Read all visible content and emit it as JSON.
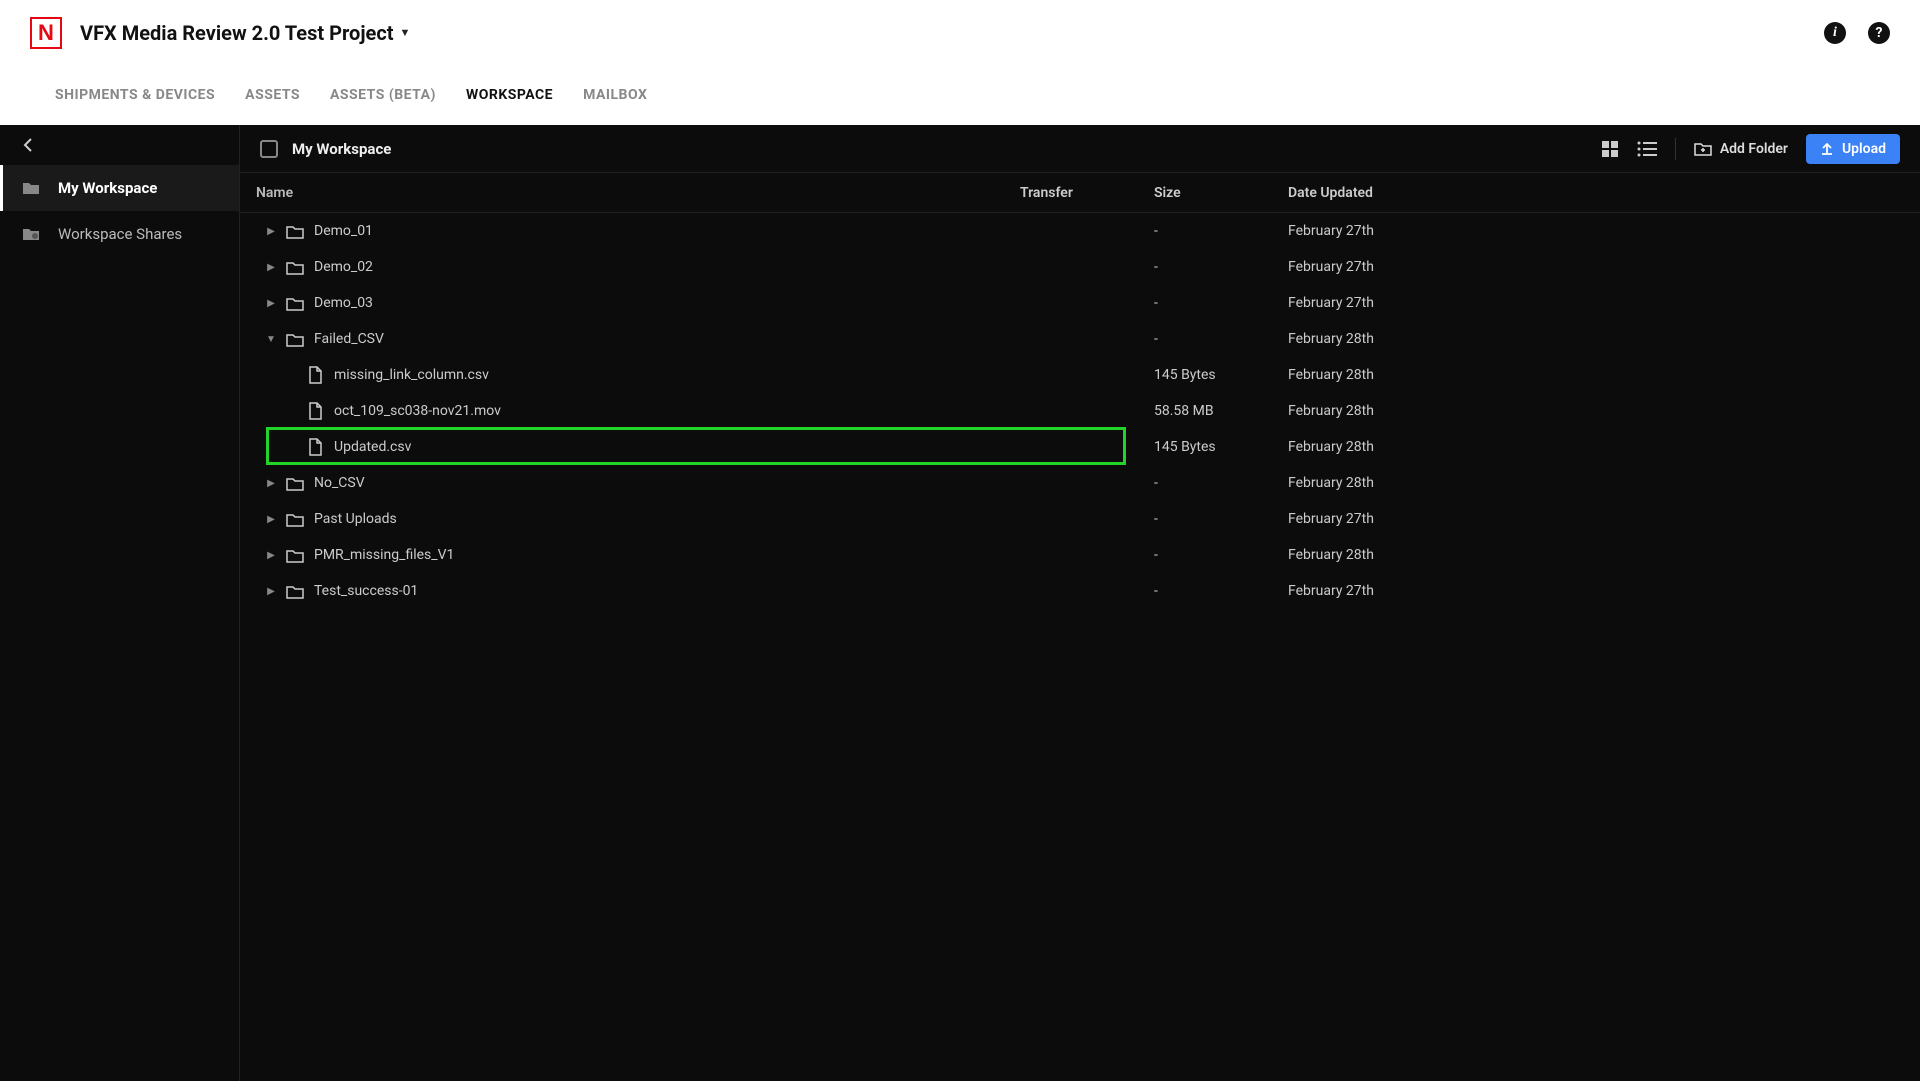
{
  "header": {
    "project_title": "VFX Media Review 2.0 Test Project"
  },
  "nav": {
    "tabs": [
      "SHIPMENTS & DEVICES",
      "ASSETS",
      "ASSETS (BETA)",
      "WORKSPACE",
      "MAILBOX"
    ],
    "active_tab": "WORKSPACE"
  },
  "sidebar": {
    "items": [
      {
        "label": "My Workspace",
        "icon": "folder",
        "active": true
      },
      {
        "label": "Workspace Shares",
        "icon": "share-folder",
        "active": false
      }
    ]
  },
  "breadcrumb": "My Workspace",
  "toolbar": {
    "add_folder_label": "Add Folder",
    "upload_label": "Upload"
  },
  "columns": {
    "name": "Name",
    "transfer": "Transfer",
    "size": "Size",
    "date": "Date Updated"
  },
  "rows": [
    {
      "type": "folder",
      "name": "Demo_01",
      "transfer": "",
      "size": "-",
      "date": "February 27th",
      "depth": 0,
      "expanded": false
    },
    {
      "type": "folder",
      "name": "Demo_02",
      "transfer": "",
      "size": "-",
      "date": "February 27th",
      "depth": 0,
      "expanded": false
    },
    {
      "type": "folder",
      "name": "Demo_03",
      "transfer": "",
      "size": "-",
      "date": "February 27th",
      "depth": 0,
      "expanded": false
    },
    {
      "type": "folder",
      "name": "Failed_CSV",
      "transfer": "",
      "size": "-",
      "date": "February 28th",
      "depth": 0,
      "expanded": true
    },
    {
      "type": "file",
      "name": "missing_link_column.csv",
      "transfer": "",
      "size": "145 Bytes",
      "date": "February 28th",
      "depth": 1
    },
    {
      "type": "file",
      "name": "oct_109_sc038-nov21.mov",
      "transfer": "",
      "size": "58.58 MB",
      "date": "February 28th",
      "depth": 1
    },
    {
      "type": "file",
      "name": "Updated.csv",
      "transfer": "",
      "size": "145 Bytes",
      "date": "February 28th",
      "depth": 1,
      "highlight": true
    },
    {
      "type": "folder",
      "name": "No_CSV",
      "transfer": "",
      "size": "-",
      "date": "February 28th",
      "depth": 0,
      "expanded": false
    },
    {
      "type": "folder",
      "name": "Past Uploads",
      "transfer": "",
      "size": "-",
      "date": "February 27th",
      "depth": 0,
      "expanded": false
    },
    {
      "type": "folder",
      "name": "PMR_missing_files_V1",
      "transfer": "",
      "size": "-",
      "date": "February 28th",
      "depth": 0,
      "expanded": false
    },
    {
      "type": "folder",
      "name": "Test_success-01",
      "transfer": "",
      "size": "-",
      "date": "February 27th",
      "depth": 0,
      "expanded": false
    }
  ]
}
